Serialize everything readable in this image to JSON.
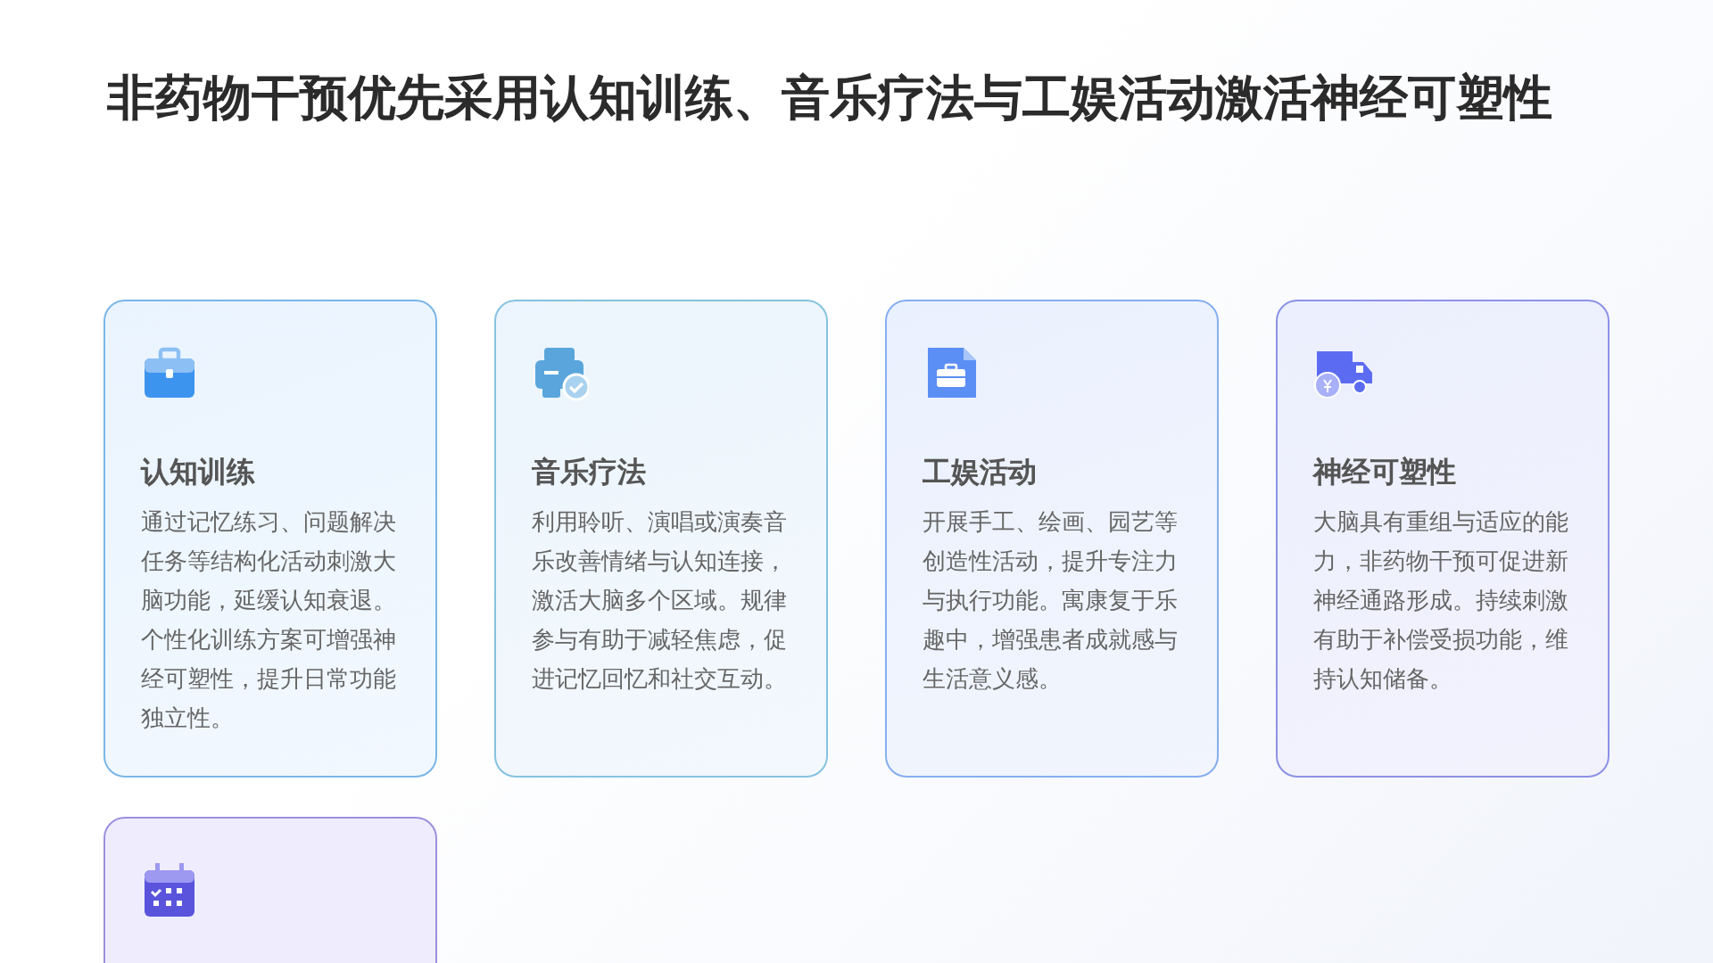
{
  "title": "非药物干预优先采用认知训练、音乐疗法与工娱活动激活神经可塑性",
  "cards": [
    {
      "kind": "briefcase",
      "heading": "认知训练",
      "text": "通过记忆练习、问题解决任务等结构化活动刺激大脑功能，延缓认知衰退。个性化训练方案可增强神经可塑性，提升日常功能独立性。"
    },
    {
      "kind": "printer",
      "heading": "音乐疗法",
      "text": "利用聆听、演唱或演奏音乐改善情绪与认知连接，激活大脑多个区域。规律参与有助于减轻焦虑，促进记忆回忆和社交互动。"
    },
    {
      "kind": "document",
      "heading": "工娱活动",
      "text": "开展手工、绘画、园艺等创造性活动，提升专注力与执行功能。寓康复于乐趣中，增强患者成就感与生活意义感。"
    },
    {
      "kind": "truck",
      "heading": "神经可塑性",
      "text": "大脑具有重组与适应的能力，非药物干预可促进新神经通路形成。持续刺激有助于补偿受损功能，维持认知储备。"
    },
    {
      "kind": "calendar"
    }
  ]
}
